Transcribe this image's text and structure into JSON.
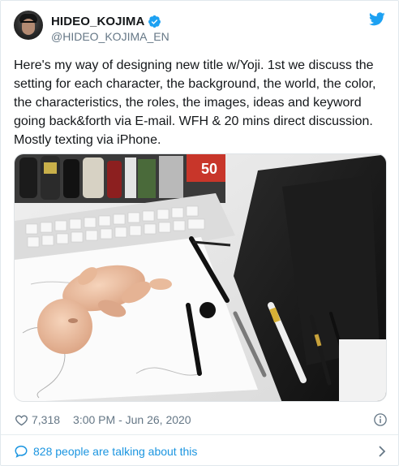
{
  "user": {
    "display_name": "HIDEO_KOJIMA",
    "handle": "@HIDEO_KOJIMA_EN"
  },
  "tweet": {
    "text": "Here's my way of designing new title w/Yoji. 1st we discuss the setting for each character, the background, the world, the color, the characteristics, the roles, the images, ideas and keyword going back&forth via E-mail. WFH & 20 mins direct discussion. Mostly texting via iPhone.",
    "likes": "7,318",
    "timestamp": "3:00 PM - Jun 26, 2020"
  },
  "conversation": {
    "label": "828 people are talking about this"
  },
  "icons": {
    "verified": "verified-badge-icon",
    "bird": "twitter-bird-icon",
    "heart": "heart-icon",
    "info": "info-icon",
    "bubble": "speech-bubble-icon",
    "chevron": "chevron-right-icon"
  },
  "colors": {
    "accent": "#1da1f2",
    "link": "#1b95e0",
    "text": "#14171a",
    "muted": "#657786"
  }
}
